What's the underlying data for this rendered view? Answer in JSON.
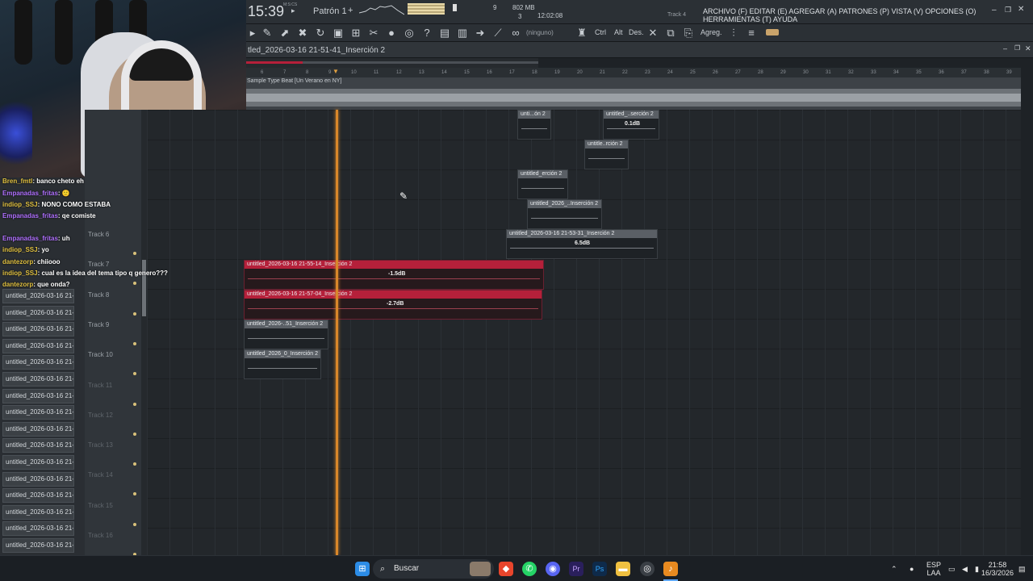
{
  "topbar": {
    "time_main": "15:39",
    "time_small": "M:S:CS",
    "pattern": "Patrón 1",
    "memory": "802 MB",
    "voices": "3",
    "clock": "12:02:08",
    "cpu_num": "9",
    "hint_track": "Track 4",
    "menu": "ARCHIVO (F) EDITAR (E) AGREGAR (A) PATRONES (P) VISTA (V) OPCIONES (O) HERRAMIENTAS (T) AYUDA"
  },
  "toolbar": {
    "snap_label": "(ninguno)",
    "ctrl": "Ctrl",
    "alt": "Alt",
    "des": "Des.",
    "agreg": "Agreg."
  },
  "playlist": {
    "title": "tled_2026-03-16 21-51-41_Inserción 2",
    "audio_track_label": "Sample Type Beat [Un Verano en NY]",
    "ruler_ticks": [
      "6",
      "7",
      "8",
      "9",
      "10",
      "11",
      "12",
      "13",
      "14",
      "15",
      "16",
      "17",
      "18",
      "19",
      "20",
      "21",
      "22",
      "23",
      "24",
      "25",
      "26",
      "27",
      "28",
      "29",
      "30",
      "31",
      "32",
      "33",
      "34",
      "35",
      "36",
      "37",
      "38",
      "39"
    ]
  },
  "tracks": [
    "Track 6",
    "Track 7",
    "Track 8",
    "Track 9",
    "Track 10",
    "Track 11",
    "Track 12",
    "Track 13",
    "Track 14",
    "Track 15",
    "Track 16"
  ],
  "clips": [
    {
      "label": "unti...ón 2",
      "db": ""
    },
    {
      "label": "untitled_..serción 2",
      "db": "0.1dB"
    },
    {
      "label": "untitle..rción 2",
      "db": ""
    },
    {
      "label": "untitled_erción 2",
      "db": ""
    },
    {
      "label": "untitled_2026_..Inserción 2",
      "db": ""
    },
    {
      "label": "untitled_2026-03-16 21-53-31_Inserción 2",
      "db": "6.5dB"
    },
    {
      "label": "untitled_2026-03-16 21-55-14_Inserción 2",
      "db": "-1.5dB"
    },
    {
      "label": "untitled_2026-03-16 21-57-04_Inserción 2",
      "db": "-2.7dB"
    },
    {
      "label": "untitled_2026-..51_Inserción 2",
      "db": ""
    },
    {
      "label": "untitled_2026_0_Inserción 2",
      "db": ""
    }
  ],
  "browser_items": [
    "untitled_2026-03-16 21-",
    "untitled_2026-03-16 21-",
    "untitled_2026-03-16 21-",
    "untitled_2026-03-16 21-",
    "untitled_2026-03-16 21-",
    "untitled_2026-03-16 21-",
    "untitled_2026-03-16 21-",
    "untitled_2026-03-16 21-",
    "untitled_2026-03-16 21-",
    "untitled_2026-03-16 21-",
    "untitled_2026-03-16 21-",
    "untitled_2026-03-16 21-",
    "untitled_2026-03-16 21-",
    "untitled_2026-03-16 21-",
    "untitled_2026-03-16 21-",
    "untitled_2026-03-16 21-"
  ],
  "chat": [
    {
      "user": "Bren_fmtl",
      "msg": ": banco cheto eh"
    },
    {
      "user": "Empanadas_fritas",
      "msg": ": 🙂"
    },
    {
      "user": "indiop_SSJ",
      "msg": ": NONO COMO ESTABA"
    },
    {
      "user": "Empanadas_fritas",
      "msg": ": qe comiste"
    },
    {
      "user": "Empanadas_fritas",
      "msg": ": uh"
    },
    {
      "user": "indiop_SSJ",
      "msg": ": yo"
    },
    {
      "user": "dantezorp",
      "msg": ": chiiooo"
    },
    {
      "user": "indiop_SSJ",
      "msg": ": cual es la idea del tema tipo q genero???"
    },
    {
      "user": "dantezorp",
      "msg": ": que onda?"
    }
  ],
  "taskbar": {
    "search": "Buscar",
    "lang_top": "ESP",
    "lang_bottom": "LAA",
    "time": "21:58",
    "date": "16/3/2026"
  },
  "colors": {
    "playhead": "#d9872a",
    "red_clip": "#b5203a",
    "accent": "#d8c17a"
  }
}
